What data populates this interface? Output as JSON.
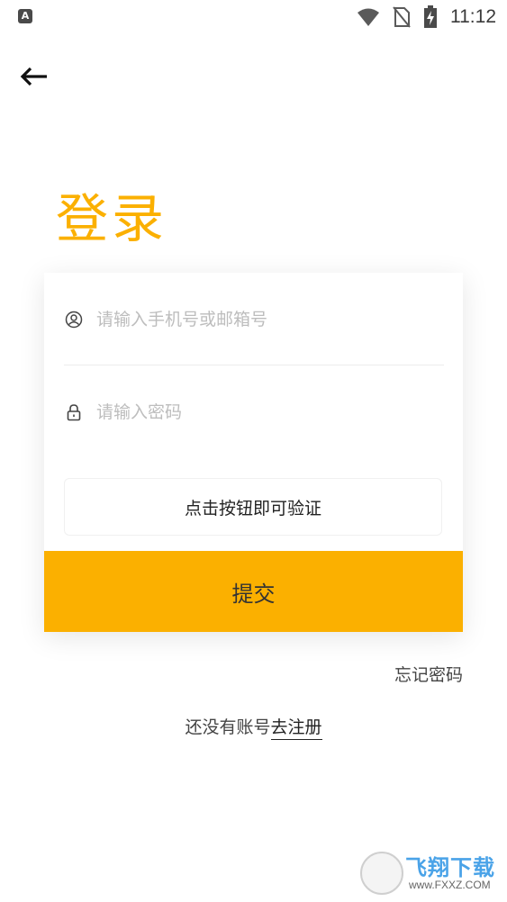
{
  "status_bar": {
    "app_icon_letter": "A",
    "time": "11:12"
  },
  "header": {
    "title": "登录"
  },
  "form": {
    "phone_placeholder": "请输入手机号或邮箱号",
    "password_placeholder": "请输入密码",
    "verify_label": "点击按钮即可验证",
    "submit_label": "提交"
  },
  "links": {
    "forgot_password": "忘记密码",
    "no_account_text": "还没有账号",
    "register": "去注册"
  },
  "watermark": {
    "brand": "飞翔下载",
    "url": "www.FXXZ.COM"
  },
  "colors": {
    "accent": "#fbb000"
  }
}
